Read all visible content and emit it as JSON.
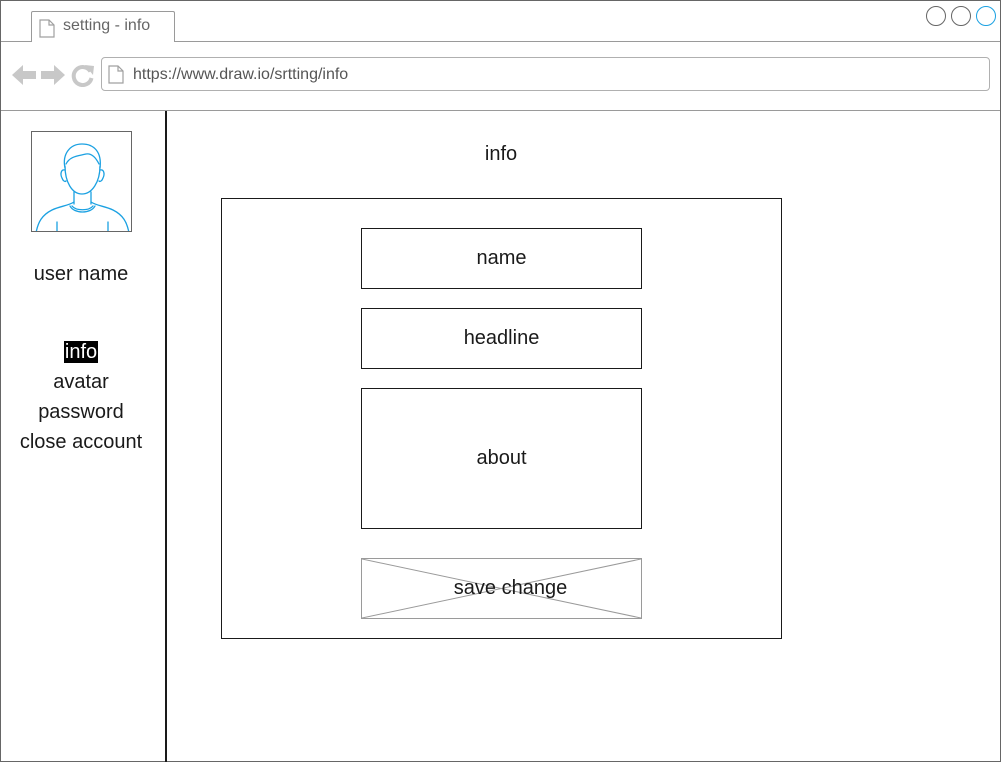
{
  "browser": {
    "tab": {
      "label": "setting - info"
    },
    "address": {
      "url": "https://www.draw.io/srtting/info"
    },
    "icons": [
      "back-arrow-icon",
      "forward-arrow-icon",
      "reload-icon",
      "document-icon"
    ],
    "window_buttons": [
      "window-control",
      "window-control",
      "window-control"
    ]
  },
  "sidebar": {
    "avatar_icon": "user-avatar-icon",
    "user_name": "user name",
    "menu": [
      {
        "label": "info",
        "active": true
      },
      {
        "label": "avatar",
        "active": false
      },
      {
        "label": "password",
        "active": false
      },
      {
        "label": "close account",
        "active": false
      }
    ]
  },
  "main": {
    "title": "info",
    "fields": {
      "name": "name",
      "headline": "headline",
      "about": "about"
    },
    "save_button": {
      "label": "save change"
    }
  },
  "colors": {
    "accent": "#1ba1e2",
    "icon_grey": "#c8c8c8",
    "border": "#1a1a1a",
    "active_menu_bg": "#000000"
  }
}
